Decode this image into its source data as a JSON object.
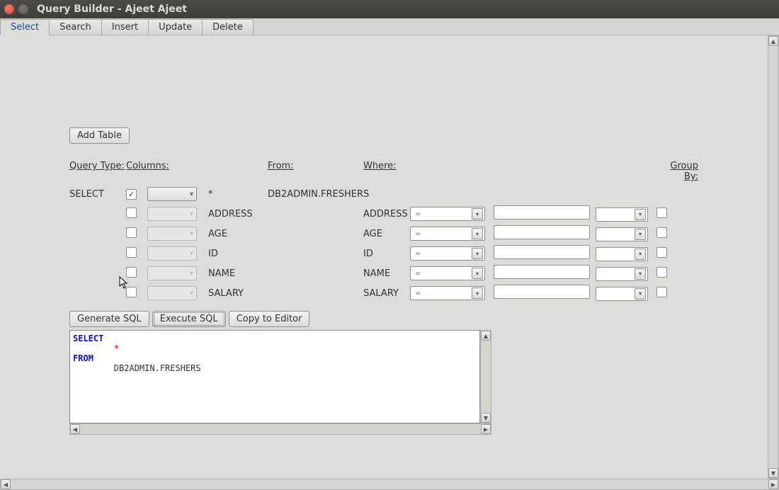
{
  "window": {
    "title": "Query Builder - Ajeet Ajeet"
  },
  "tabs": [
    "Select",
    "Search",
    "Insert",
    "Update",
    "Delete"
  ],
  "active_tab": "Select",
  "buttons": {
    "add_table": "Add Table",
    "generate_sql": "Generate SQL",
    "execute_sql": "Execute SQL",
    "copy_to_editor": "Copy to Editor"
  },
  "headers": {
    "query_type": "Query Type:",
    "columns": "Columns:",
    "from": "From:",
    "where": "Where:",
    "group_by": "Group By:"
  },
  "query_type_value": "SELECT",
  "from_table": "DB2ADMIN.FRESHERS",
  "columns": [
    {
      "checked": true,
      "name": "*",
      "agg_enabled": true,
      "where_col": "",
      "where_op": ""
    },
    {
      "checked": false,
      "name": "ADDRESS",
      "agg_enabled": false,
      "where_col": "ADDRESS",
      "where_op": "="
    },
    {
      "checked": false,
      "name": "AGE",
      "agg_enabled": false,
      "where_col": "AGE",
      "where_op": "="
    },
    {
      "checked": false,
      "name": "ID",
      "agg_enabled": false,
      "where_col": "ID",
      "where_op": "="
    },
    {
      "checked": false,
      "name": "NAME",
      "agg_enabled": false,
      "where_col": "NAME",
      "where_op": "="
    },
    {
      "checked": false,
      "name": "SALARY",
      "agg_enabled": false,
      "where_col": "SALARY",
      "where_op": "="
    }
  ],
  "sql": {
    "kw_select": "SELECT",
    "star": "*",
    "kw_from": "FROM",
    "table": "DB2ADMIN.FRESHERS"
  }
}
